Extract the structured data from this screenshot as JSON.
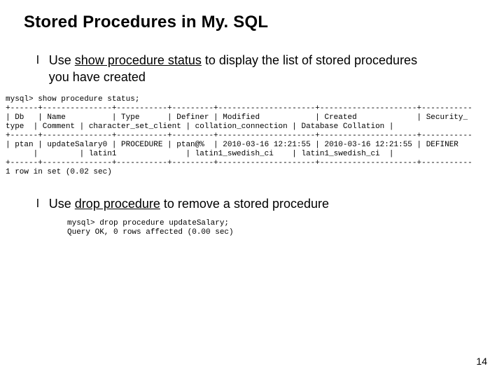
{
  "title": "Stored Procedures in My. SQL",
  "bullets": [
    {
      "prefix": "Use ",
      "emph": "show procedure status",
      "rest": " to display the list of stored procedures you have created"
    },
    {
      "prefix": "Use ",
      "emph": "drop procedure",
      "rest": " to remove a stored procedure"
    }
  ],
  "code1": "mysql> show procedure status;\n+------+---------------+-----------+---------+---------------------+---------------------+-----------\n| Db   | Name          | Type      | Definer | Modified            | Created             | Security_\ntype  | Comment | character_set_client | collation_connection | Database Collation |\n+------+---------------+-----------+---------+---------------------+---------------------+-----------\n| ptan | updateSalary0 | PROCEDURE | ptan@%  | 2010-03-16 12:21:55 | 2010-03-16 12:21:55 | DEFINER\n      |         | latin1               | latin1_swedish_ci    | latin1_swedish_ci  |\n+------+---------------+-----------+---------+---------------------+---------------------+-----------\n1 row in set (0.02 sec)",
  "code2": "mysql> drop procedure updateSalary;\nQuery OK, 0 rows affected (0.00 sec)",
  "page_number": "14"
}
